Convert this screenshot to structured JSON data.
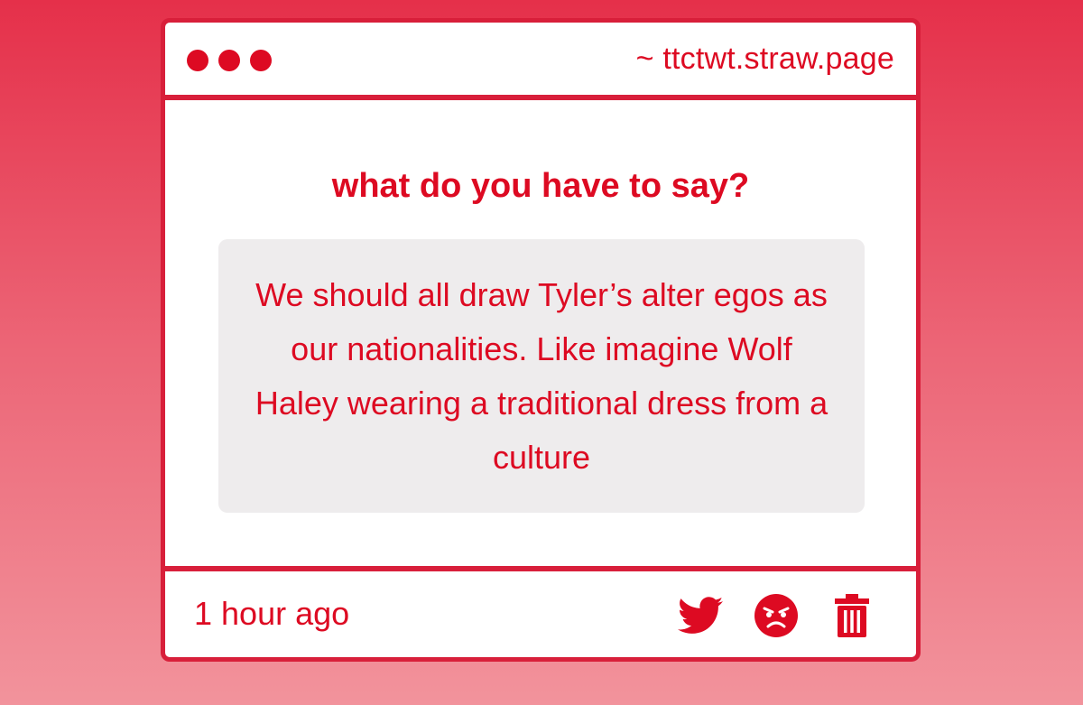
{
  "window": {
    "url": "~ ttctwt.straw.page"
  },
  "main": {
    "question": "what do you have to say?",
    "message": "We should all draw Tyler’s alter egos as our nationalities. Like imagine Wolf Haley wearing a traditional dress from a culture"
  },
  "footer": {
    "timestamp": "1 hour ago",
    "actions": [
      "twitter-icon",
      "angry-face-icon",
      "trash-icon"
    ]
  },
  "colors": {
    "accent": "#dd0a22",
    "border": "#d81f3a",
    "message_bg": "#eeeced"
  }
}
